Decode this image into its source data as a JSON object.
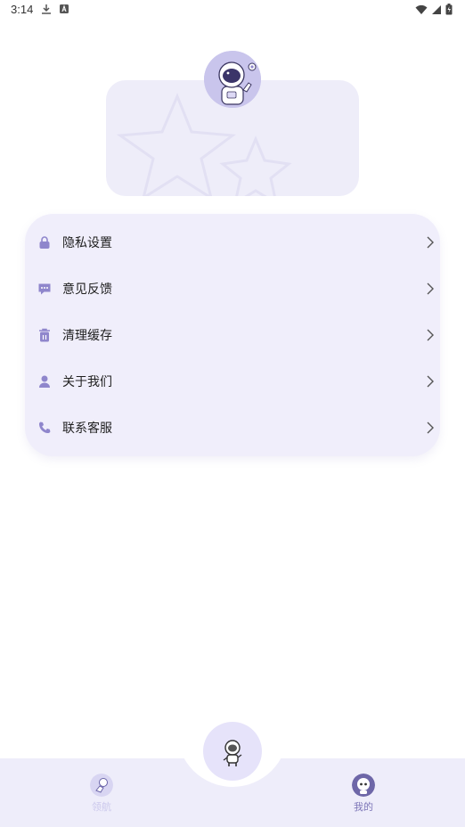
{
  "status_bar": {
    "time": "3:14"
  },
  "menu": [
    {
      "label": "隐私设置",
      "icon": "lock-icon"
    },
    {
      "label": "意见反馈",
      "icon": "message-icon"
    },
    {
      "label": "清理缓存",
      "icon": "trash-icon"
    },
    {
      "label": "关于我们",
      "icon": "person-icon"
    },
    {
      "label": "联系客服",
      "icon": "phone-icon"
    }
  ],
  "tabs": [
    {
      "label": "领航",
      "icon": "astronaut-flying-icon",
      "active": false
    },
    {
      "label": "我的",
      "icon": "astronaut-face-icon",
      "active": true
    }
  ],
  "colors": {
    "accent": "#8f86cc",
    "card": "#eeedf9",
    "tabbar": "#eeedfa"
  }
}
